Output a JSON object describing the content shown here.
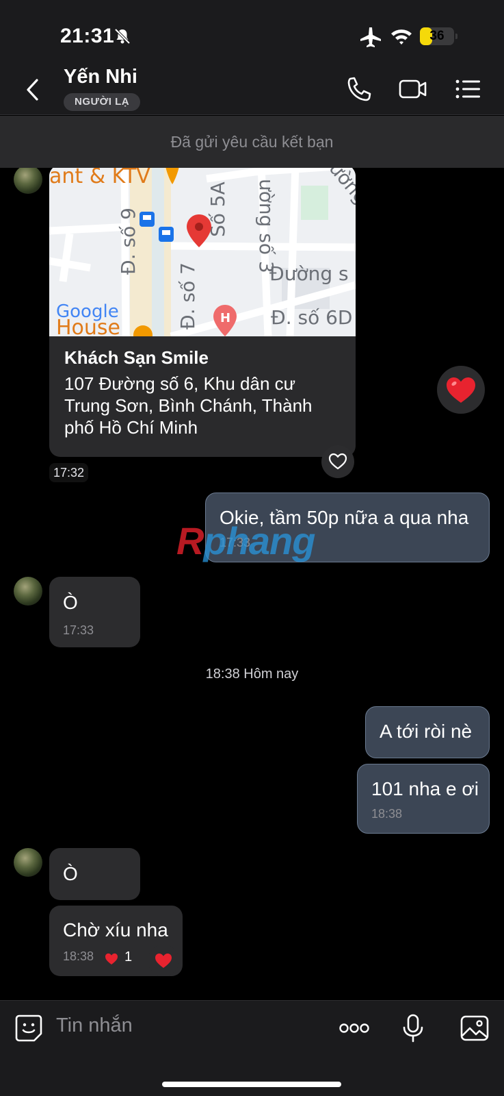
{
  "status_bar": {
    "time": "21:31",
    "battery_percent": "36",
    "battery_level": 0.36
  },
  "header": {
    "contact_name": "Yến Nhi",
    "stranger_badge": "NGƯỜI LẠ"
  },
  "friend_request_notice": "Đã gửi yêu cầu kết bạn",
  "map": {
    "labels": [
      "ant & KTV",
      "Đ. số 9",
      "Số 5A",
      "ường số 3",
      "Đường s",
      "Đ. số 7",
      "Đ. số 6D",
      "ường s",
      "House"
    ],
    "logo": "Google"
  },
  "location_message": {
    "title": "Khách Sạn Smile",
    "address": "107 Đường số 6, Khu dân cư Trung Sơn, Bình Chánh, Thành phố Hồ Chí Minh",
    "time": "17:32"
  },
  "messages": [
    {
      "id": "m1",
      "sender": "me",
      "text": "Okie, tầm 50p nữa a qua nha",
      "time": "17:33"
    },
    {
      "id": "m2",
      "sender": "contact",
      "text": "Ò",
      "time": "17:33"
    },
    {
      "id": "m3",
      "sender": "me",
      "text": "A tới ròi nè",
      "time": ""
    },
    {
      "id": "m4",
      "sender": "me",
      "text": "101 nha e ơi",
      "time": "18:38"
    },
    {
      "id": "m5",
      "sender": "contact",
      "text": "Ò",
      "time": ""
    },
    {
      "id": "m6",
      "sender": "contact",
      "text": "Chờ xíu nha",
      "time": "18:38"
    }
  ],
  "date_divider": "18:38 Hôm nay",
  "reaction_count": "1",
  "watermark": {
    "part1": "R",
    "part2": "phang"
  },
  "input": {
    "placeholder": "Tin nhắn"
  },
  "colors": {
    "heart": "#e8232f",
    "outgoing_bubble": "#3c4655",
    "incoming_bubble": "#2c2c2e",
    "battery": "#f5d90a"
  }
}
